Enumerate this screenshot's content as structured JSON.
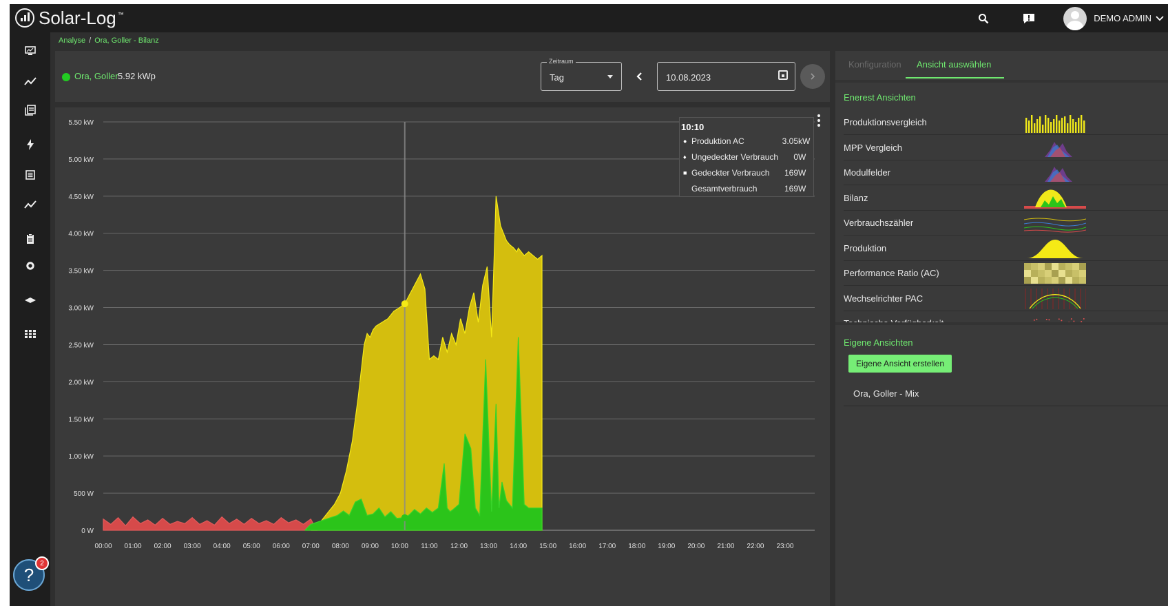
{
  "app": {
    "brand": "Solar-Log",
    "trademark": "™",
    "user": "DEMO ADMIN",
    "notification_count": "2"
  },
  "breadcrumb": {
    "root": "Analyse",
    "separator": "/",
    "current": "Ora, Goller - Bilanz"
  },
  "device": {
    "name": "Ora, Goller",
    "kwp": "5.92 kWp",
    "status_color": "#22cc22"
  },
  "period": {
    "label": "Zeitraum",
    "value": "Tag"
  },
  "date": {
    "value": "10.08.2023"
  },
  "tooltip": {
    "time": "10:10",
    "rows": [
      {
        "marker": "●",
        "label": "Produktion AC",
        "value": "3.05",
        "unit": "kW"
      },
      {
        "marker": "♦",
        "label": "Ungedeckter Verbrauch",
        "value": "0",
        "unit": "W"
      },
      {
        "marker": "■",
        "label": "Gedeckter Verbrauch",
        "value": "169",
        "unit": "W"
      },
      {
        "marker": "",
        "label": "Gesamtverbrauch",
        "value": "169",
        "unit": "W"
      }
    ]
  },
  "tabs": {
    "config": "Konfiguration",
    "select": "Ansicht auswählen"
  },
  "views": {
    "title": "Enerest Ansichten",
    "items": [
      {
        "label": "Produktionsvergleich",
        "thumb": "bars"
      },
      {
        "label": "MPP Vergleich",
        "thumb": "mpp"
      },
      {
        "label": "Modulfelder",
        "thumb": "mpp"
      },
      {
        "label": "Bilanz",
        "thumb": "bilanz"
      },
      {
        "label": "Verbrauchszähler",
        "thumb": "lines"
      },
      {
        "label": "Produktion",
        "thumb": "bell"
      },
      {
        "label": "Performance Ratio (AC)",
        "thumb": "heat"
      },
      {
        "label": "Wechselrichter PAC",
        "thumb": "pac"
      },
      {
        "label": "Technische Verfügbarkeit",
        "thumb": "dots"
      }
    ]
  },
  "own_views": {
    "title": "Eigene Ansichten",
    "create_label": "Eigene Ansicht erstellen",
    "items": [
      "Ora, Goller - Mix"
    ]
  },
  "colors": {
    "accent": "#6fe86f",
    "production": "#d4be0e",
    "production_line": "#f5ea16",
    "covered": "#2bc41a",
    "uncovered": "#d64a4a"
  },
  "chart_data": {
    "type": "area",
    "x_unit": "hours",
    "xlim": [
      0,
      24
    ],
    "ylim": [
      0,
      5500
    ],
    "y_unit": "W",
    "y_ticks": [
      {
        "v": 0,
        "label": "0 W"
      },
      {
        "v": 500,
        "label": "500 W"
      },
      {
        "v": 1000,
        "label": "1.00 kW"
      },
      {
        "v": 1500,
        "label": "1.50 kW"
      },
      {
        "v": 2000,
        "label": "2.00 kW"
      },
      {
        "v": 2500,
        "label": "2.50 kW"
      },
      {
        "v": 3000,
        "label": "3.00 kW"
      },
      {
        "v": 3500,
        "label": "3.50 kW"
      },
      {
        "v": 4000,
        "label": "4.00 kW"
      },
      {
        "v": 4500,
        "label": "4.50 kW"
      },
      {
        "v": 5000,
        "label": "5.00 kW"
      },
      {
        "v": 5500,
        "label": "5.50 kW"
      }
    ],
    "x_ticks": [
      "00:00",
      "01:00",
      "02:00",
      "03:00",
      "04:00",
      "05:00",
      "06:00",
      "07:00",
      "08:00",
      "09:00",
      "10:00",
      "11:00",
      "12:00",
      "13:00",
      "14:00",
      "15:00",
      "16:00",
      "17:00",
      "18:00",
      "19:00",
      "20:00",
      "21:00",
      "22:00",
      "23:00"
    ],
    "grid": true,
    "crosshair_x": 10.17,
    "series": [
      {
        "name": "Produktion AC",
        "x": [
          7.0,
          7.3,
          7.6,
          7.8,
          8.0,
          8.2,
          8.4,
          8.6,
          8.8,
          8.9,
          9.0,
          9.1,
          9.2,
          9.4,
          9.6,
          9.8,
          10.0,
          10.17,
          10.3,
          10.5,
          10.7,
          10.85,
          11.0,
          11.15,
          11.3,
          11.45,
          11.6,
          11.75,
          11.9,
          12.05,
          12.2,
          12.35,
          12.5,
          12.65,
          12.8,
          12.95,
          13.1,
          13.25,
          13.4,
          13.5,
          13.6,
          13.7,
          13.85,
          13.95,
          14.0,
          14.1,
          14.2,
          14.35,
          14.5,
          14.65,
          14.8
        ],
        "values": [
          0,
          100,
          250,
          350,
          500,
          800,
          1200,
          1800,
          2500,
          2650,
          2600,
          2700,
          2750,
          2800,
          2850,
          2950,
          3000,
          3050,
          3150,
          3300,
          3450,
          3250,
          2300,
          2350,
          2300,
          2600,
          2400,
          2650,
          2500,
          2850,
          2650,
          3000,
          3200,
          2800,
          3300,
          3550,
          2600,
          4500,
          4100,
          4000,
          3900,
          3850,
          3800,
          3750,
          3800,
          3750,
          3700,
          3750,
          3700,
          3650,
          3700
        ]
      },
      {
        "name": "Gedeckter Verbrauch",
        "x": [
          6.8,
          7.0,
          7.3,
          7.6,
          7.9,
          8.1,
          8.3,
          8.5,
          8.7,
          8.9,
          9.1,
          9.3,
          9.5,
          9.7,
          9.9,
          10.1,
          10.3,
          10.5,
          10.7,
          10.9,
          11.1,
          11.3,
          11.5,
          11.6,
          11.7,
          11.8,
          12.0,
          12.2,
          12.4,
          12.55,
          12.7,
          12.9,
          13.1,
          13.25,
          13.35,
          13.45,
          13.6,
          13.8,
          14.0,
          14.2,
          14.35,
          14.45,
          14.55,
          14.7,
          14.8
        ],
        "values": [
          0,
          80,
          120,
          160,
          200,
          260,
          200,
          380,
          420,
          200,
          220,
          300,
          180,
          250,
          160,
          169,
          200,
          280,
          220,
          300,
          240,
          300,
          900,
          300,
          250,
          280,
          350,
          1300,
          1100,
          300,
          200,
          2300,
          250,
          1700,
          300,
          650,
          400,
          300,
          2600,
          350,
          300,
          300,
          300,
          300,
          300
        ]
      },
      {
        "name": "Ungedeckter Verbrauch",
        "x": [
          0.0,
          0.25,
          0.5,
          0.75,
          1.0,
          1.25,
          1.5,
          1.75,
          2.0,
          2.25,
          2.5,
          2.75,
          3.0,
          3.25,
          3.5,
          3.75,
          4.0,
          4.25,
          4.5,
          4.75,
          5.0,
          5.25,
          5.5,
          5.75,
          6.0,
          6.25,
          6.5,
          6.75,
          7.0,
          7.2
        ],
        "values": [
          150,
          80,
          170,
          60,
          180,
          90,
          140,
          70,
          160,
          80,
          120,
          90,
          170,
          80,
          130,
          70,
          180,
          90,
          150,
          80,
          160,
          90,
          130,
          80,
          170,
          100,
          140,
          80,
          150,
          0
        ]
      }
    ]
  }
}
